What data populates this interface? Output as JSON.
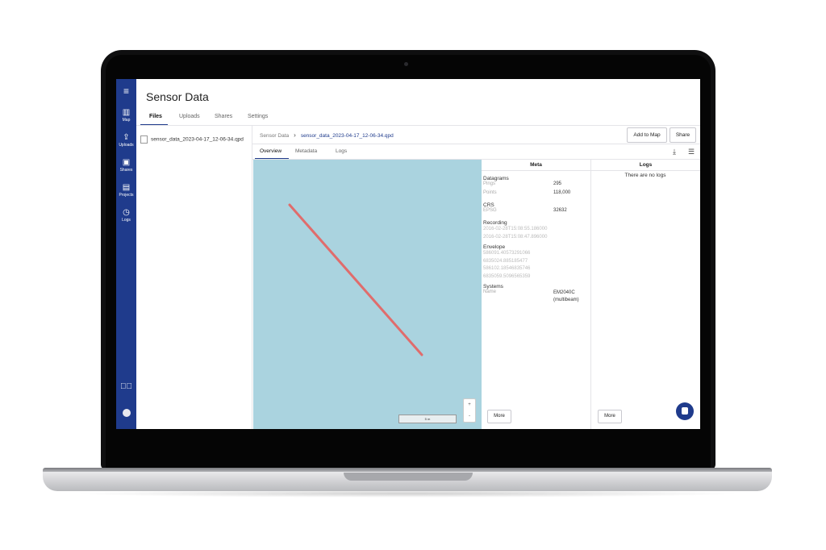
{
  "app": {
    "title": "Sensor Data"
  },
  "sidebar": {
    "items": [
      {
        "label": "Map",
        "icon": "map-icon"
      },
      {
        "label": "Uploads",
        "icon": "upload-icon"
      },
      {
        "label": "Shares",
        "icon": "share-icon"
      },
      {
        "label": "Projects",
        "icon": "projects-icon"
      },
      {
        "label": "Logs",
        "icon": "history-icon"
      }
    ]
  },
  "tabs": [
    "Files",
    "Uploads",
    "Shares",
    "Settings"
  ],
  "files": [
    "sensor_data_2023-04-17_12-06-34.qpd"
  ],
  "breadcrumb": {
    "root": "Sensor Data",
    "current": "sensor_data_2023-04-17_12-06-34.qpd"
  },
  "actions": {
    "add_to_map": "Add to Map",
    "share": "Share"
  },
  "subtabs": [
    "Overview",
    "Metadata",
    "Logs"
  ],
  "map": {
    "scale_label": "5 m",
    "zoom_in": "+",
    "zoom_out": "-"
  },
  "meta": {
    "title": "Meta",
    "datagrams_title": "Datagrams",
    "pings_label": "Pings",
    "pings_value": "295",
    "points_label": "Points",
    "points_value": "118,000",
    "crs_title": "CRS",
    "epsg_label": "EPSG",
    "epsg_value": "32632",
    "recording_title": "Recording",
    "recording_lines": [
      "2016-02-28T15:08:55.186000",
      "2016-02-28T15:08:47.896000"
    ],
    "envelope_title": "Envelope",
    "envelope_lines": [
      "586091.40573291066",
      "6835024.885185477",
      "586102.18546835746",
      "6835059.5096565359"
    ],
    "systems_title": "Systems",
    "name_label": "Name",
    "systems_value_1": "EM2040C",
    "systems_value_2": "(multibeam)",
    "more": "More"
  },
  "logs": {
    "title": "Logs",
    "empty": "There are no logs",
    "more": "More"
  },
  "colors": {
    "sidebar": "#1f3b8c",
    "map_water": "#aad3df",
    "track": "#e06c6c"
  }
}
